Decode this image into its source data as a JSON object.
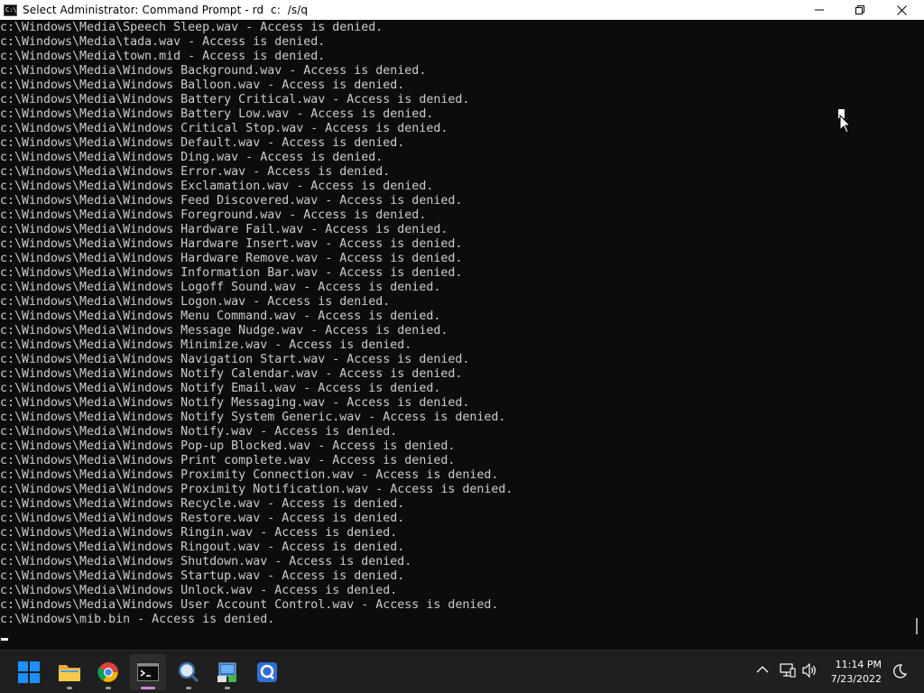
{
  "window": {
    "title": "Select Administrator: Command Prompt - rd  c:  /s/q",
    "app_icon_text": "C:\\"
  },
  "console": {
    "lines": [
      "c:\\Windows\\Media\\Speech Sleep.wav - Access is denied.",
      "c:\\Windows\\Media\\tada.wav - Access is denied.",
      "c:\\Windows\\Media\\town.mid - Access is denied.",
      "c:\\Windows\\Media\\Windows Background.wav - Access is denied.",
      "c:\\Windows\\Media\\Windows Balloon.wav - Access is denied.",
      "c:\\Windows\\Media\\Windows Battery Critical.wav - Access is denied.",
      "c:\\Windows\\Media\\Windows Battery Low.wav - Access is denied.",
      "c:\\Windows\\Media\\Windows Critical Stop.wav - Access is denied.",
      "c:\\Windows\\Media\\Windows Default.wav - Access is denied.",
      "c:\\Windows\\Media\\Windows Ding.wav - Access is denied.",
      "c:\\Windows\\Media\\Windows Error.wav - Access is denied.",
      "c:\\Windows\\Media\\Windows Exclamation.wav - Access is denied.",
      "c:\\Windows\\Media\\Windows Feed Discovered.wav - Access is denied.",
      "c:\\Windows\\Media\\Windows Foreground.wav - Access is denied.",
      "c:\\Windows\\Media\\Windows Hardware Fail.wav - Access is denied.",
      "c:\\Windows\\Media\\Windows Hardware Insert.wav - Access is denied.",
      "c:\\Windows\\Media\\Windows Hardware Remove.wav - Access is denied.",
      "c:\\Windows\\Media\\Windows Information Bar.wav - Access is denied.",
      "c:\\Windows\\Media\\Windows Logoff Sound.wav - Access is denied.",
      "c:\\Windows\\Media\\Windows Logon.wav - Access is denied.",
      "c:\\Windows\\Media\\Windows Menu Command.wav - Access is denied.",
      "c:\\Windows\\Media\\Windows Message Nudge.wav - Access is denied.",
      "c:\\Windows\\Media\\Windows Minimize.wav - Access is denied.",
      "c:\\Windows\\Media\\Windows Navigation Start.wav - Access is denied.",
      "c:\\Windows\\Media\\Windows Notify Calendar.wav - Access is denied.",
      "c:\\Windows\\Media\\Windows Notify Email.wav - Access is denied.",
      "c:\\Windows\\Media\\Windows Notify Messaging.wav - Access is denied.",
      "c:\\Windows\\Media\\Windows Notify System Generic.wav - Access is denied.",
      "c:\\Windows\\Media\\Windows Notify.wav - Access is denied.",
      "c:\\Windows\\Media\\Windows Pop-up Blocked.wav - Access is denied.",
      "c:\\Windows\\Media\\Windows Print complete.wav - Access is denied.",
      "c:\\Windows\\Media\\Windows Proximity Connection.wav - Access is denied.",
      "c:\\Windows\\Media\\Windows Proximity Notification.wav - Access is denied.",
      "c:\\Windows\\Media\\Windows Recycle.wav - Access is denied.",
      "c:\\Windows\\Media\\Windows Restore.wav - Access is denied.",
      "c:\\Windows\\Media\\Windows Ringin.wav - Access is denied.",
      "c:\\Windows\\Media\\Windows Ringout.wav - Access is denied.",
      "c:\\Windows\\Media\\Windows Shutdown.wav - Access is denied.",
      "c:\\Windows\\Media\\Windows Startup.wav - Access is denied.",
      "c:\\Windows\\Media\\Windows Unlock.wav - Access is denied.",
      "c:\\Windows\\Media\\Windows User Account Control.wav - Access is denied.",
      "c:\\Windows\\mib.bin - Access is denied."
    ]
  },
  "taskbar": {
    "apps": [
      {
        "name": "start-button",
        "icon": "windows-logo-icon",
        "active": false
      },
      {
        "name": "file-explorer-button",
        "icon": "folder-icon",
        "active": false
      },
      {
        "name": "chrome-button",
        "icon": "chrome-icon",
        "active": false
      },
      {
        "name": "command-prompt-button",
        "icon": "terminal-icon",
        "active": true
      },
      {
        "name": "magnifier-button",
        "icon": "magnifier-icon",
        "active": false
      },
      {
        "name": "control-panel-button",
        "icon": "control-panel-icon",
        "active": false
      },
      {
        "name": "quick-assist-button",
        "icon": "quick-assist-icon",
        "active": false
      }
    ],
    "clock": {
      "time": "11:14 PM",
      "date": "7/23/2022"
    }
  },
  "colors": {
    "console_bg": "#0c0c0c",
    "console_text": "#cccccc",
    "titlebar_bg": "#ffffff",
    "taskbar_bg": "#1f1f1f",
    "accent": "#0078d4"
  }
}
